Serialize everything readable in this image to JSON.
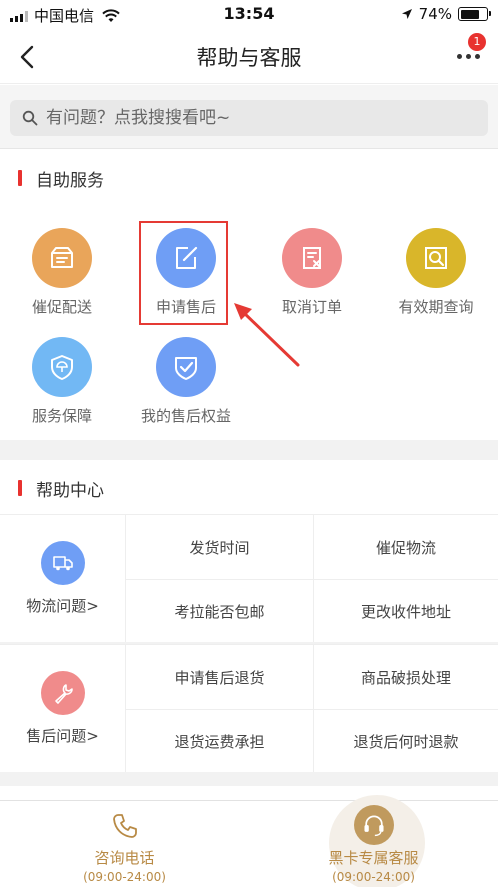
{
  "status_bar": {
    "carrier": "中国电信",
    "time": "13:54",
    "battery": "74%",
    "battery_level": 0.74
  },
  "nav": {
    "title": "帮助与客服",
    "badge_count": "1"
  },
  "search": {
    "placeholder": "有问题？点我搜搜看吧~"
  },
  "self_service": {
    "title": "自助服务",
    "items": [
      {
        "label": "催促配送",
        "icon": "box-icon",
        "color": "#e9a55a"
      },
      {
        "label": "申请售后",
        "icon": "edit-square-icon",
        "color": "#6f9ef5",
        "highlighted": true
      },
      {
        "label": "取消订单",
        "icon": "cancel-order-icon",
        "color": "#f08b8b"
      },
      {
        "label": "有效期查询",
        "icon": "search-square-icon",
        "color": "#d9b62a"
      },
      {
        "label": "服务保障",
        "icon": "shield-umbrella-icon",
        "color": "#72b8f4"
      },
      {
        "label": "我的售后权益",
        "icon": "shield-check-icon",
        "color": "#6f9ef5"
      }
    ]
  },
  "help_center": {
    "title": "帮助中心",
    "groups": [
      {
        "label": "物流问题>",
        "icon": "truck-icon",
        "color": "#6f9ef5",
        "links": [
          "发货时间",
          "催促物流",
          "考拉能否包邮",
          "更改收件地址"
        ]
      },
      {
        "label": "售后问题>",
        "icon": "wrench-icon",
        "color": "#f08b8b",
        "links": [
          "申请售后退货",
          "商品破损处理",
          "退货运费承担",
          "退货后何时退款"
        ]
      }
    ]
  },
  "bottom_bar": {
    "phone": {
      "label": "咨询电话",
      "hours": "(09:00-24:00)",
      "icon": "phone-icon"
    },
    "vip": {
      "label": "黑卡专属客服",
      "hours": "(09:00-24:00)",
      "icon": "headset-icon"
    }
  },
  "colors": {
    "accent_red": "#e8322f",
    "gold": "#b88a45"
  }
}
